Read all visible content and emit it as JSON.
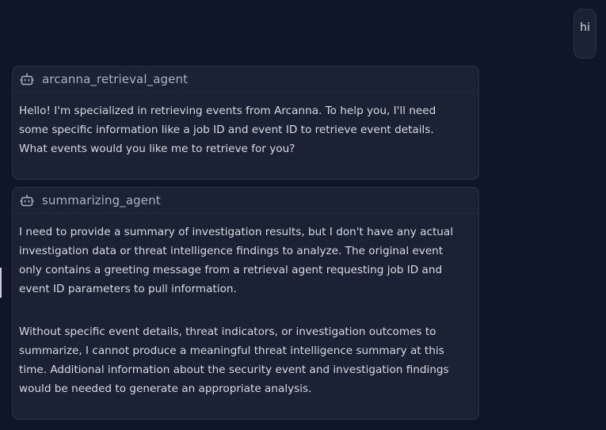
{
  "user_message": {
    "text": "hi"
  },
  "messages": [
    {
      "agent": "arcanna_retrieval_agent",
      "icon": "bot-icon",
      "paragraphs": [
        "Hello! I'm specialized in retrieving events from Arcanna. To help you, I'll need some specific information like a job ID and event ID to retrieve event details. What events would you like me to retrieve for you?"
      ]
    },
    {
      "agent": "summarizing_agent",
      "icon": "bot-icon",
      "paragraphs": [
        "I need to provide a summary of investigation results, but I don't have any actual investigation data or threat intelligence findings to analyze. The original event only contains a greeting message from a retrieval agent requesting job ID and event ID parameters to pull information.",
        "Without specific event details, threat indicators, or investigation outcomes to summarize, I cannot produce a meaningful threat intelligence summary at this time. Additional information about the security event and investigation findings would be needed to generate an appropriate analysis."
      ]
    }
  ],
  "colors": {
    "background": "#0f1628",
    "card": "#1a2233",
    "card_border": "#263044",
    "agent_name": "#aab3c2",
    "body_text": "#d6dbe4"
  }
}
